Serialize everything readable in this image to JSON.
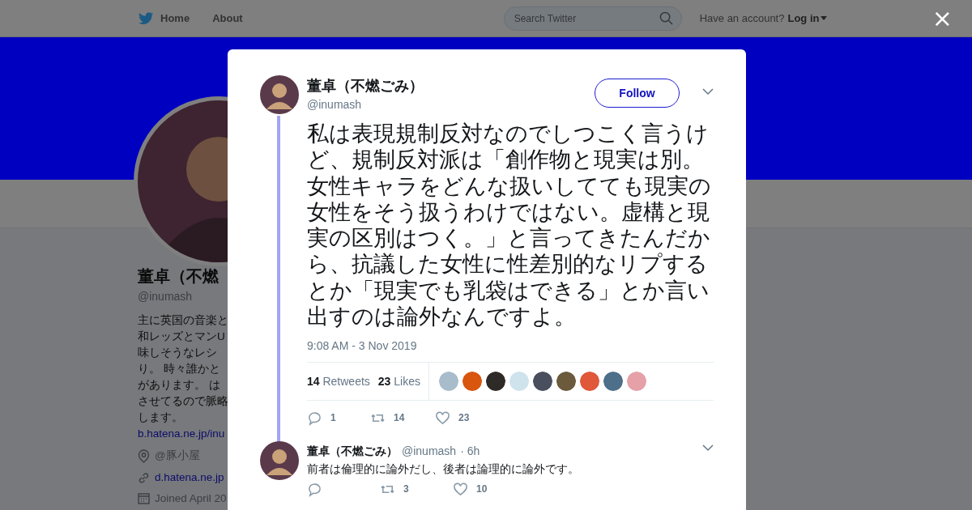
{
  "topbar": {
    "nav": [
      {
        "kind": "logo",
        "label": "Home"
      },
      {
        "kind": "plain",
        "label": "About"
      }
    ],
    "search": {
      "placeholder": "Search Twitter"
    },
    "account_prompt": "Have an account?",
    "login": "Log in",
    "close": "×"
  },
  "profile": {
    "name": "董卓（不燃",
    "handle": "@inumash",
    "bio_lines": [
      "主に英国の音楽と",
      "和レッズとマンU",
      "味しそうなレシ",
      "り。 時々誰かと",
      "があります。 は",
      "させてるので脈略",
      "します。"
    ],
    "bio_link": "b.hatena.ne.jp/inu",
    "location": "@豚小屋",
    "website": "d.hatena.ne.jp",
    "joined": "Joined April 20"
  },
  "tweet": {
    "name": "董卓（不燃ごみ）",
    "handle": "@inumash",
    "follow": "Follow",
    "text": "私は表現規制反対なのでしつこく言うけど、規制反対派は「創作物と現実は別。女性キャラをどんな扱いしてても現実の女性をそう扱うわけではない。虚構と現実の区別はつく。」と言ってきたんだから、抗議した女性に性差別的なリプするとか「現実でも乳袋はできる」とか言い出すのは論外なんですよ。",
    "time": "9:08 AM - 3 Nov 2019",
    "stats": [
      {
        "count": "14",
        "label": "Retweets"
      },
      {
        "count": "23",
        "label": "Likes"
      }
    ],
    "likers": [
      {
        "color": "#a9bccb"
      },
      {
        "color": "#d8560e"
      },
      {
        "color": "#2e2a28"
      },
      {
        "color": "#cfe3ec"
      },
      {
        "color": "#4a4f5e"
      },
      {
        "color": "#6b5a3c"
      },
      {
        "color": "#e0573a"
      },
      {
        "color": "#4d6f8a"
      },
      {
        "color": "#e6a0a8"
      }
    ],
    "actions": [
      {
        "kind": "reply",
        "count": "1"
      },
      {
        "kind": "retweet",
        "count": "14"
      },
      {
        "kind": "like",
        "count": "23"
      }
    ]
  },
  "reply": {
    "name": "董卓（不燃ごみ）",
    "handle": "@inumash",
    "time": "· 6h",
    "text": "前者は倫理的に論外だし、後者は論理的に論外です。",
    "actions": [
      {
        "kind": "reply"
      },
      {
        "kind": "retweet",
        "count": "3"
      },
      {
        "kind": "like",
        "count": "10"
      }
    ]
  }
}
